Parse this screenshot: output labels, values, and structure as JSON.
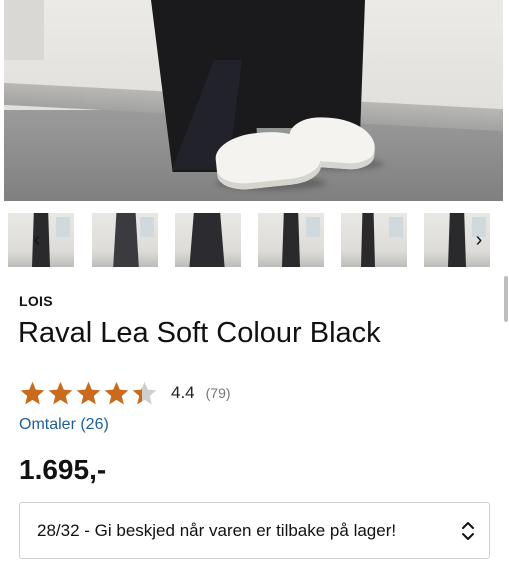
{
  "gallery": {
    "main_image_alt": "Raval Lea Soft Colour Black",
    "thumbnail_count": 6,
    "prev_icon": "chevron-left-icon",
    "next_icon": "chevron-right-icon",
    "prev_glyph": "‹",
    "next_glyph": "›"
  },
  "product": {
    "brand": "LOIS",
    "title": "Raval Lea Soft Colour Black",
    "rating_value": "4.4",
    "rating_count": "(79)",
    "rating_stars": 4.4,
    "reviews_link": "Omtaler (26)",
    "price": "1.695,-"
  },
  "size_select": {
    "selected": "28/32 - Gi beskjed når varen er tilbake på lager!",
    "icon": "chevron-up-down-icon"
  },
  "colors": {
    "star": "#c96a1c",
    "star_empty": "#cfcfcf",
    "link": "#1f5f9a",
    "text": "#111111"
  }
}
